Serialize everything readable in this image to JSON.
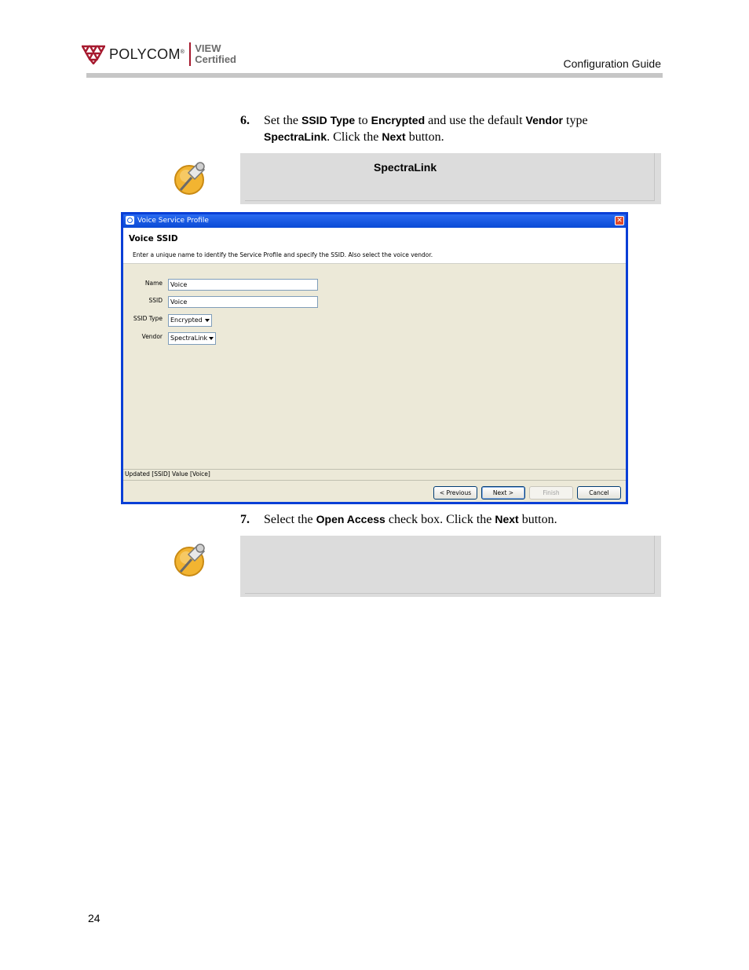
{
  "header": {
    "logo": {
      "brand": "POLYCOM",
      "brand_mark": "®",
      "cert_line1": "VIEW",
      "cert_line2": "Certified"
    },
    "guide_title": "Configuration Guide"
  },
  "step6": {
    "number": "6.",
    "t1": "Set the ",
    "ui1": "SSID Type",
    "t2": " to ",
    "ui2": "Encrypted",
    "t3": " and use the default ",
    "ui3": "Vendor",
    "t4": " type",
    "ui4": "SpectraLink",
    "t5": ". Click the ",
    "ui5": "Next",
    "t6": " button."
  },
  "note1": {
    "icon": "pushpin-note-icon",
    "title": "SpectraLink"
  },
  "dialog": {
    "window_title": "Voice Service Profile",
    "close_glyph": "✕",
    "heading": "Voice SSID",
    "description": "Enter a unique name to identify the Service Profile and specify the SSID. Also select the voice vendor.",
    "fields": {
      "name_label": "Name",
      "name_value": "Voice",
      "ssid_label": "SSID",
      "ssid_value": "Voice",
      "ssid_type_label": "SSID Type",
      "ssid_type_value": "Encrypted",
      "vendor_label": "Vendor",
      "vendor_value": "SpectraLink"
    },
    "status_text": "Updated [SSID] Value [Voice]",
    "buttons": {
      "previous": "< Previous",
      "next": "Next >",
      "finish": "Finish",
      "cancel": "Cancel"
    }
  },
  "step7": {
    "number": "7.",
    "t1": "Select the ",
    "ui1": "Open Access",
    "t2": " check box. Click the ",
    "ui2": "Next",
    "t3": " button."
  },
  "note2": {
    "icon": "pushpin-note-icon"
  },
  "page_number": "24"
}
